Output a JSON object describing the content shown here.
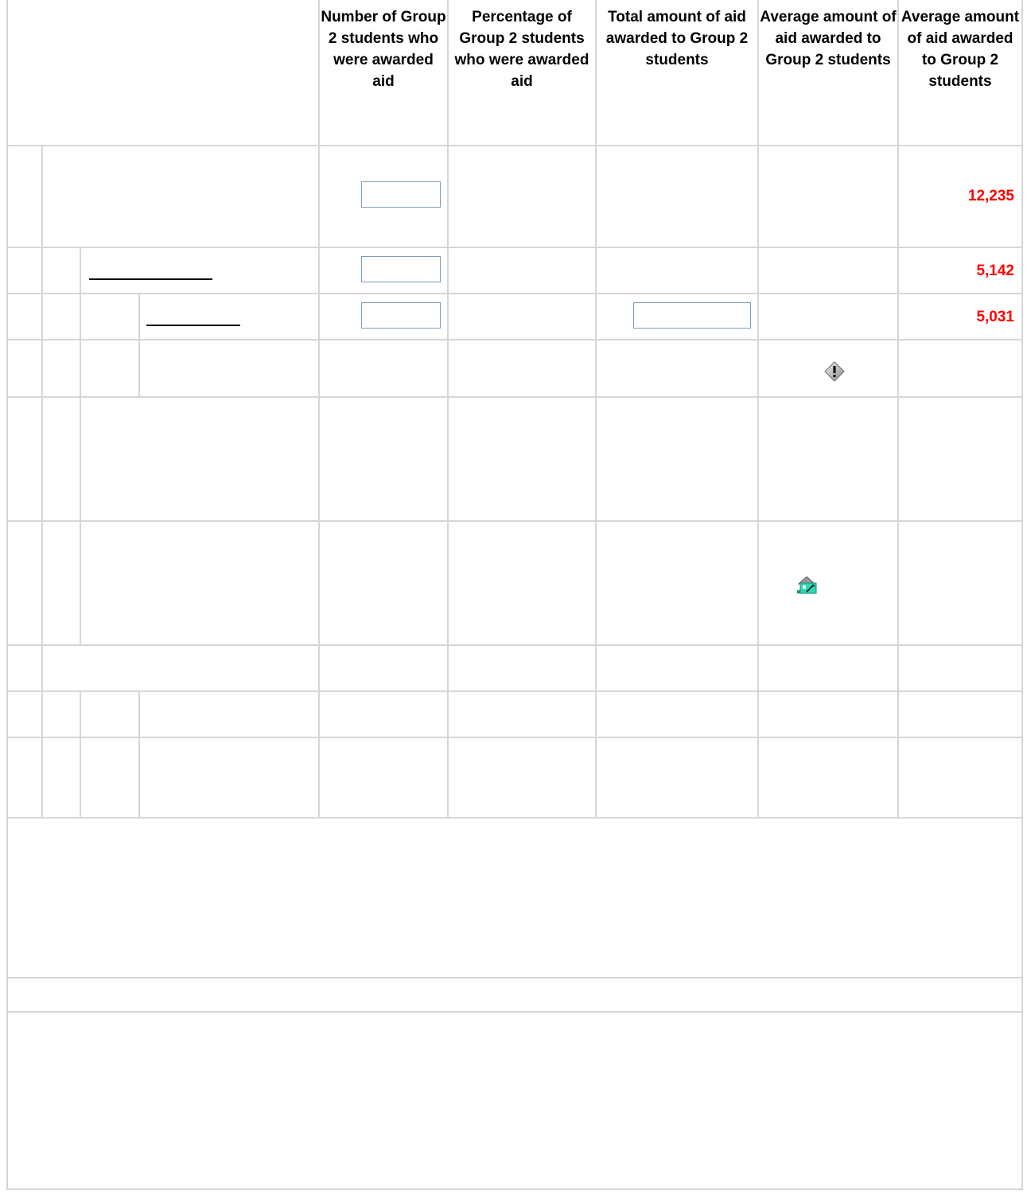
{
  "headers": [
    "Number of Group 2 students who were awarded aid",
    "Percentage of Group 2 students who were awarded aid",
    "Total amount of aid awarded to Group 2 students",
    "Average amount of aid awarded to Group 2 students",
    "Average amount of aid awarded to Group 2 students"
  ],
  "rows": {
    "row1": {
      "input_value": "",
      "average_value": "12,235"
    },
    "row2": {
      "input_value": "",
      "average_value": "5,142"
    },
    "row3": {
      "input_value": "",
      "total_input_value": "",
      "average_value": "5,031"
    }
  },
  "icons": {
    "warning": "warning-diamond-icon",
    "calculate": "calculate-icon"
  },
  "colors": {
    "value_text": "#ff0000",
    "grid": "#d6d6d6",
    "input_border": "#7f9db9"
  }
}
